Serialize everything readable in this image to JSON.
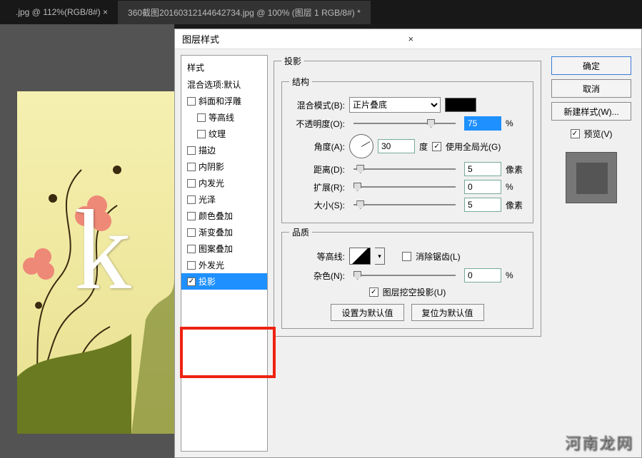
{
  "tabs": {
    "left": ".jpg @ 112%(RGB/8#) ×",
    "right": "360截图20160312144642734.jpg @ 100% (图层 1 RGB/8#) *"
  },
  "dialog": {
    "title": "图层样式",
    "close": "×"
  },
  "styles": {
    "header": "样式",
    "default_label": "混合选项:默认",
    "items": [
      {
        "label": "斜面和浮雕",
        "checked": false
      },
      {
        "label": "等高线",
        "checked": false,
        "indent": true
      },
      {
        "label": "纹理",
        "checked": false,
        "indent": true
      },
      {
        "label": "描边",
        "checked": false
      },
      {
        "label": "内阴影",
        "checked": false
      },
      {
        "label": "内发光",
        "checked": false
      },
      {
        "label": "光泽",
        "checked": false
      },
      {
        "label": "颜色叠加",
        "checked": false
      },
      {
        "label": "渐变叠加",
        "checked": false
      },
      {
        "label": "图案叠加",
        "checked": false
      },
      {
        "label": "外发光",
        "checked": false
      },
      {
        "label": "投影",
        "checked": true,
        "selected": true
      }
    ]
  },
  "shadow": {
    "section": "投影",
    "structure": "结构",
    "blend_label": "混合模式(B):",
    "blend_value": "正片叠底",
    "opacity_label": "不透明度(O):",
    "opacity_value": "75",
    "angle_label": "角度(A):",
    "angle_value": "30",
    "angle_unit": "度",
    "global_light": "使用全局光(G)",
    "distance_label": "距离(D):",
    "distance_value": "5",
    "px": "像素",
    "spread_label": "扩展(R):",
    "spread_value": "0",
    "pct": "%",
    "size_label": "大小(S):",
    "size_value": "5"
  },
  "quality": {
    "section": "品质",
    "contour_label": "等高线:",
    "antialias": "消除锯齿(L)",
    "noise_label": "杂色(N):",
    "noise_value": "0",
    "knockout": "图层挖空投影(U)",
    "set_default": "设置为默认值",
    "reset_default": "复位为默认值"
  },
  "buttons": {
    "ok": "确定",
    "cancel": "取消",
    "new_style": "新建样式(W)...",
    "preview": "预览(V)"
  },
  "canvas_letter": "k",
  "watermark": "河南龙网"
}
